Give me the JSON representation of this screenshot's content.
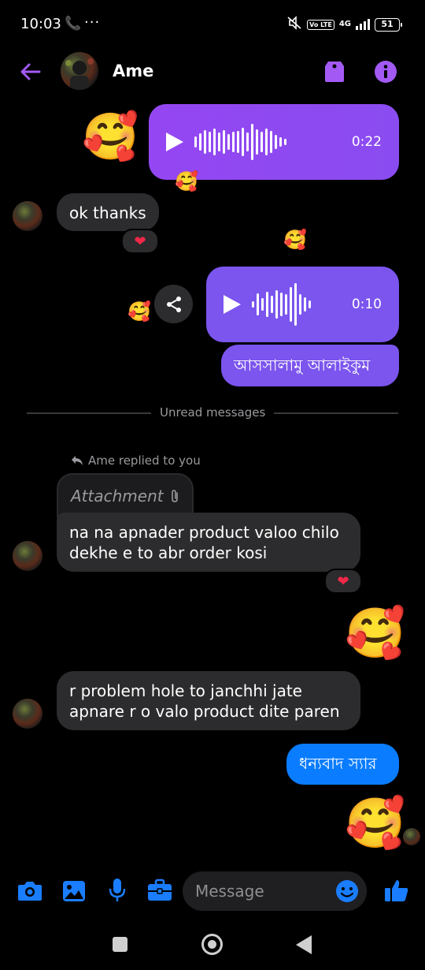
{
  "status_bar": {
    "time": "10:03",
    "call_icon": "phone-icon",
    "dots": "···",
    "lte": "Vo LTE",
    "network": "4G",
    "battery": "51"
  },
  "header": {
    "name": "Ame",
    "accent_color": "#9b4df5"
  },
  "messages": {
    "voice1_duration": "0:22",
    "ok_thanks": "ok thanks",
    "voice2_duration": "0:10",
    "salam": "আসসালামু আলাইকুম",
    "unread_label": "Unread messages",
    "replied_label": "Ame replied to you",
    "attachment_label": "Attachment",
    "reply_text_line1": "na na apnader product valoo chilo",
    "reply_text_line2": "dekhe e to abr order kosi",
    "problem_line1": "r problem hole to janchhi jate",
    "problem_line2": "apnare r o valo product dite paren",
    "thanks_sir": "ধন্যবাদ স্যার",
    "reaction_heart": "❤",
    "emoji_smiling_hearts": "🥰"
  },
  "composer": {
    "placeholder": "Message"
  },
  "colors": {
    "purple": "#9446f2",
    "blue": "#0a7cff",
    "toolbar_blue": "#1a7dff",
    "gray_bubble": "#2c2c2e"
  }
}
